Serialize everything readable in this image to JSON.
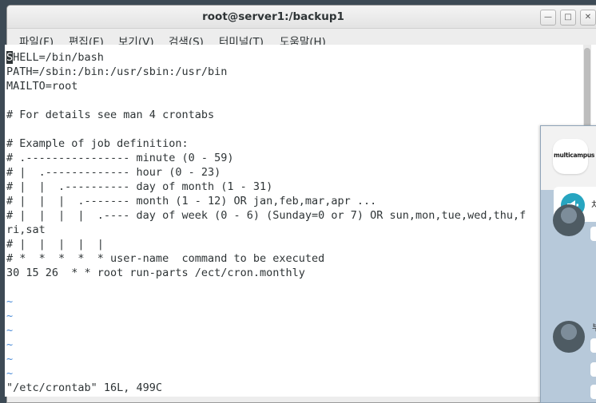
{
  "window": {
    "title": "root@server1:/backup1"
  },
  "menu": [
    {
      "label": "파일(F)"
    },
    {
      "label": "편집(E)"
    },
    {
      "label": "보기(V)"
    },
    {
      "label": "검색(S)"
    },
    {
      "label": "터미널(T)"
    },
    {
      "label": "도움말(H)"
    }
  ],
  "terminal": {
    "cursor_char": "S",
    "first_line_rest": "HELL=/bin/bash",
    "lines": [
      "PATH=/sbin:/bin:/usr/sbin:/usr/bin",
      "MAILTO=root",
      "",
      "# For details see man 4 crontabs",
      "",
      "# Example of job definition:",
      "# .---------------- minute (0 - 59)",
      "# |  .------------- hour (0 - 23)",
      "# |  |  .---------- day of month (1 - 31)",
      "# |  |  |  .------- month (1 - 12) OR jan,feb,mar,apr ...",
      "# |  |  |  |  .---- day of week (0 - 6) (Sunday=0 or 7) OR sun,mon,tue,wed,thu,f",
      "ri,sat",
      "# |  |  |  |  |",
      "# *  *  *  *  * user-name  command to be executed",
      "30 15 26  * * root run-parts /ect/cron.monthly",
      ""
    ],
    "tildes": [
      "~",
      "~",
      "~",
      "~",
      "~",
      "~"
    ],
    "status": "\"/etc/crontab\" 16L, 499C"
  },
  "chat": {
    "brand": "multicampus",
    "notice_text": "차",
    "sender_initial": "부"
  },
  "colors": {
    "tilde": "#4b8bd6",
    "notice_icon": "#27a5c0"
  }
}
